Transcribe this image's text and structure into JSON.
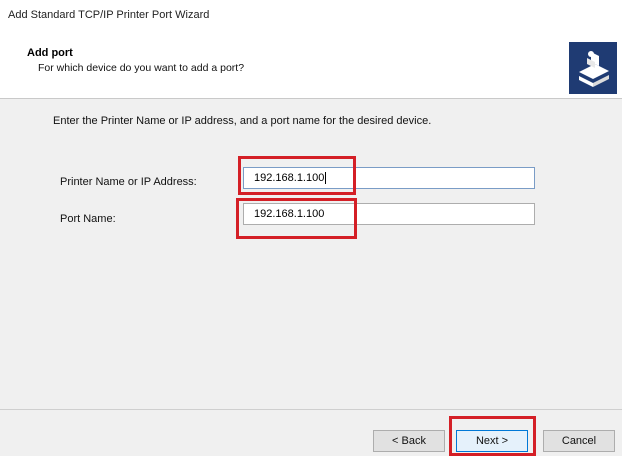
{
  "window": {
    "title": "Add Standard TCP/IP Printer Port Wizard"
  },
  "header": {
    "title": "Add port",
    "subtitle": "For which device do you want to add a port?",
    "icon": "printer-network-icon"
  },
  "main": {
    "instruction": "Enter the Printer Name or IP address, and a port name for the desired device.",
    "fields": [
      {
        "label": "Printer Name or IP Address:",
        "value": "192.168.1.100"
      },
      {
        "label": "Port Name:",
        "value": "192.168.1.100"
      }
    ]
  },
  "buttons": {
    "back": "< Back",
    "next": "Next >",
    "cancel": "Cancel"
  },
  "colors": {
    "highlight": "#d41f26",
    "focus_border": "#0078d7",
    "logo_bg": "#1f3b73"
  }
}
